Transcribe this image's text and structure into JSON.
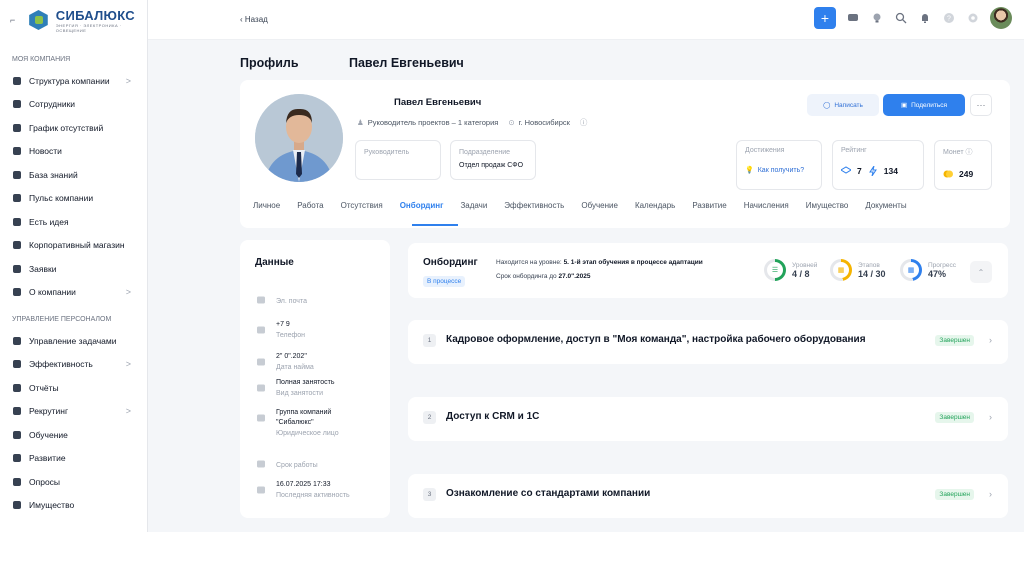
{
  "brand": {
    "name": "СИБАЛЮКС",
    "tagline": "ЭНЕРГИЯ · ЭЛЕКТРОНИКА · ОСВЕЩЕНИЕ",
    "accent": "#2f80ed"
  },
  "sidebar": {
    "section1": "МОЯ КОМПАНИЯ",
    "items1": [
      {
        "label": "Структура компании",
        "icon": "structure-icon",
        "chevron": ">"
      },
      {
        "label": "Сотрудники",
        "icon": "people-icon"
      },
      {
        "label": "График отсутствий",
        "icon": "calendar-icon"
      },
      {
        "label": "Новости",
        "icon": "news-icon"
      },
      {
        "label": "База знаний",
        "icon": "book-icon"
      },
      {
        "label": "Пульс компании",
        "icon": "pulse-icon"
      },
      {
        "label": "Есть идея",
        "icon": "bulb-icon"
      },
      {
        "label": "Корпоративный магазин",
        "icon": "shop-icon"
      },
      {
        "label": "Заявки",
        "icon": "request-icon"
      },
      {
        "label": "О компании",
        "icon": "info-icon",
        "chevron": ">"
      }
    ],
    "section2": "УПРАВЛЕНИЕ ПЕРСОНАЛОМ",
    "items2": [
      {
        "label": "Управление задачами",
        "icon": "tasks-icon"
      },
      {
        "label": "Эффективность",
        "icon": "efficiency-icon",
        "chevron": ">"
      },
      {
        "label": "Отчёты",
        "icon": "report-icon"
      },
      {
        "label": "Рекрутинг",
        "icon": "recruit-icon",
        "chevron": ">"
      },
      {
        "label": "Обучение",
        "icon": "education-icon"
      },
      {
        "label": "Развитие",
        "icon": "growth-icon"
      },
      {
        "label": "Опросы",
        "icon": "survey-icon"
      },
      {
        "label": "Имущество",
        "icon": "property-icon"
      }
    ]
  },
  "topbar": {
    "back": "‹ Назад",
    "plus": "+"
  },
  "profile": {
    "page_title": "Профиль",
    "page_name": "Павел Евгеньевич",
    "name": "Павел Евгеньевич",
    "position": "Руководитель проектов – 1 категория",
    "city": "г. Новосибирск",
    "manager_label": "Руководитель",
    "division_label": "Подразделение",
    "division_value": "Отдел продаж СФО",
    "write_button": "Написать",
    "share_button": "Поделиться",
    "more_button": "···",
    "achievements_label": "Достижения",
    "achievements_link": "Как получить?",
    "rating_label": "Рейтинг",
    "rating_value": "7",
    "rating_value2": "134",
    "coins_label": "Монет",
    "coins_value": "249"
  },
  "tabs": [
    {
      "label": "Личное"
    },
    {
      "label": "Работа"
    },
    {
      "label": "Отсутствия"
    },
    {
      "label": "Онбординг",
      "active": true
    },
    {
      "label": "Задачи"
    },
    {
      "label": "Эффективность"
    },
    {
      "label": "Обучение"
    },
    {
      "label": "Календарь"
    },
    {
      "label": "Развитие"
    },
    {
      "label": "Начисления"
    },
    {
      "label": "Имущество"
    },
    {
      "label": "Документы"
    }
  ],
  "data_card": {
    "title": "Данные",
    "fields": [
      {
        "value": "",
        "label": "Эл. почта",
        "icon": "mail-icon"
      },
      {
        "value": "+7 9",
        "label": "Телефон",
        "icon": "phone-icon"
      },
      {
        "value": "2\" 0\".202\"",
        "label": "Дата найма",
        "icon": "calendar-icon"
      },
      {
        "value": "Полная занятость",
        "label": "Вид занятости",
        "icon": "briefcase-icon"
      },
      {
        "value": "Группа компаний \"Сибалюкс\"",
        "label": "Юридическое лицо",
        "icon": "building-icon"
      },
      {
        "value": "",
        "label": "Срок работы",
        "icon": "clock-icon"
      },
      {
        "value": "16.07.2025 17:33",
        "label": "Последняя активность",
        "icon": "activity-icon"
      }
    ]
  },
  "onboarding": {
    "title": "Онбординг",
    "badge": "В процессе",
    "level_prefix": "Находится на уровне:",
    "level_value": "5. 1-й этап обучения в процессе адаптации",
    "deadline_prefix": "Срок онбординга до",
    "deadline_value": "27.0\".2025",
    "levels_label": "Уровней",
    "levels_value": "4 / 8",
    "levels_progress": 0.5,
    "stages_label": "Этапов",
    "stages_value": "14 / 30",
    "stages_progress": 0.47,
    "progress_label": "Прогресс",
    "progress_value": "47%",
    "progress_fraction": 0.47,
    "stages": [
      {
        "num": "1",
        "title": "Кадровое оформление, доступ в \"Моя команда\", настройка рабочего оборудования",
        "status": "Завершен"
      },
      {
        "num": "2",
        "title": "Доступ к CRM и 1С",
        "status": "Завершен"
      },
      {
        "num": "3",
        "title": "Ознакомление со стандартами компании",
        "status": "Завершен"
      }
    ]
  }
}
